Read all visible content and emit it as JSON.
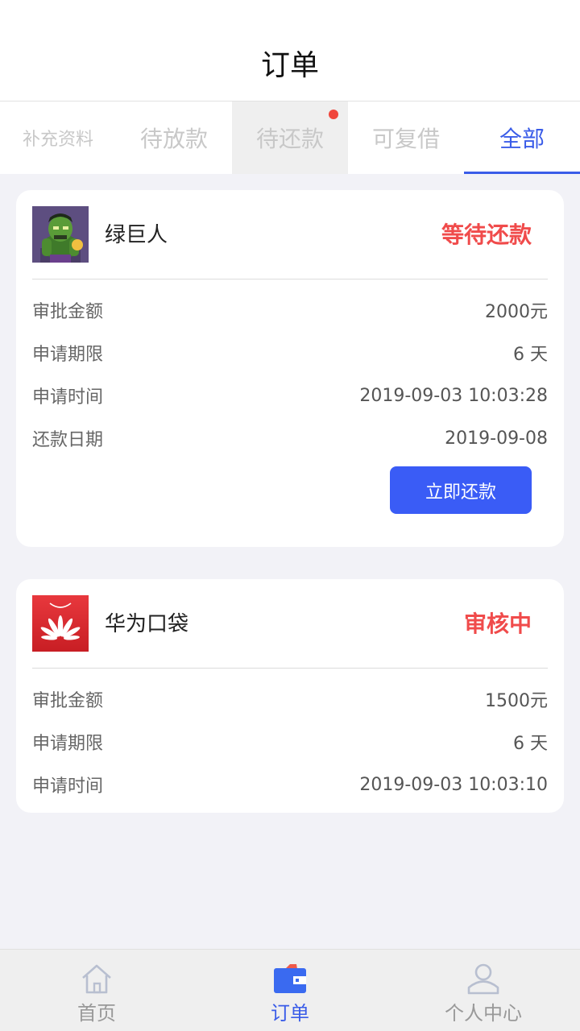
{
  "header": {
    "title": "订单"
  },
  "tabs": [
    {
      "label": "补充资料"
    },
    {
      "label": "待放款"
    },
    {
      "label": "待还款"
    },
    {
      "label": "可复借"
    },
    {
      "label": "全部"
    }
  ],
  "colors": {
    "accent": "#3a5ce8",
    "status_red": "#f04b4b",
    "badge_dot": "#f0463c",
    "button_blue": "#3a5cf6"
  },
  "orders": [
    {
      "name": "绿巨人",
      "status": "等待还款",
      "rows": [
        {
          "label": "审批金额",
          "value": "2000元"
        },
        {
          "label": "申请期限",
          "value": "6 天"
        },
        {
          "label": "申请时间",
          "value": "2019-09-03 10:03:28"
        },
        {
          "label": "还款日期",
          "value": "2019-09-08"
        }
      ],
      "action_label": "立即还款"
    },
    {
      "name": "华为口袋",
      "status": "审核中",
      "rows": [
        {
          "label": "审批金额",
          "value": "1500元"
        },
        {
          "label": "申请期限",
          "value": "6 天"
        },
        {
          "label": "申请时间",
          "value": "2019-09-03 10:03:10"
        }
      ]
    }
  ],
  "bottom_nav": [
    {
      "label": "首页",
      "icon": "home-icon"
    },
    {
      "label": "订单",
      "icon": "wallet-icon"
    },
    {
      "label": "个人中心",
      "icon": "user-icon"
    }
  ]
}
